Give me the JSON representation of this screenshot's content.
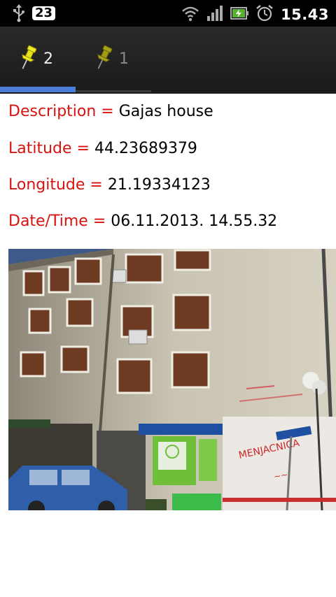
{
  "status_bar": {
    "notification_count": "23",
    "time": "15.43",
    "icons": [
      "usb-icon",
      "wifi-icon",
      "signal-icon",
      "battery-icon",
      "alarm-icon"
    ]
  },
  "tabs": [
    {
      "label": "2",
      "icon": "pushpin-icon",
      "selected": true
    },
    {
      "label": "1",
      "icon": "pushpin-icon",
      "selected": false
    }
  ],
  "details": {
    "description": {
      "label": "Description = ",
      "value": "Gajas house"
    },
    "latitude": {
      "label": "Latitude = ",
      "value": "44.23689379"
    },
    "longitude": {
      "label": "Longitude = ",
      "value": "21.19334123"
    },
    "datetime": {
      "label": "Date/Time = ",
      "value": "06.11.2013. 14.55.32"
    }
  },
  "photo": {
    "sign_text": "MENJACNICA"
  },
  "colors": {
    "label_red": "#d8130f",
    "tab_accent": "#4a7ed8",
    "pin_yellow": "#e8e020"
  }
}
